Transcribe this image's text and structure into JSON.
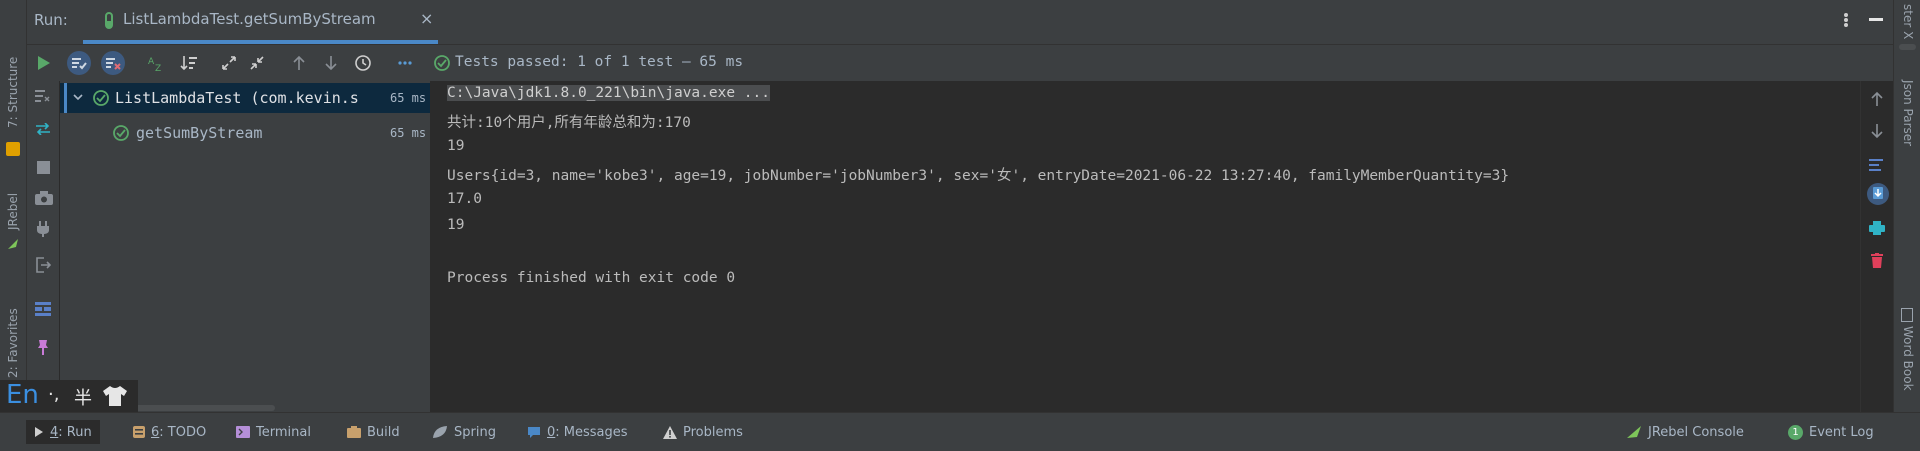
{
  "run_panel": {
    "label": "Run:",
    "tab_title": "ListLambdaTest.getSumByStream",
    "status": "Tests passed: 1 of 1 test – 65 ms"
  },
  "left_strip": {
    "structure_label": "7: Structure",
    "jrebel_label": "JRebel",
    "favorites_label": "2: Favorites"
  },
  "right_strip": {
    "top_label": "ster X",
    "json_label": "Json Parser",
    "word_label": "Word Book"
  },
  "tree": {
    "root": {
      "label": "ListLambdaTest (com.kevin.s",
      "time": "65 ms"
    },
    "child": {
      "label": "getSumByStream",
      "time": "65 ms"
    }
  },
  "console": {
    "lines": [
      "C:\\Java\\jdk1.8.0_221\\bin\\java.exe ...",
      "共计:10个用户,所有年龄总和为:170",
      "19",
      "Users{id=3, name='kobe3', age=19, jobNumber='jobNumber3', sex='女', entryDate=2021-06-22 13:27:40, familyMemberQuantity=3}",
      "17.0",
      "19",
      "",
      "Process finished with exit code 0"
    ]
  },
  "bottom_bar": {
    "run": {
      "num": "4",
      "label": ": Run"
    },
    "todo": {
      "num": "6",
      "label": ": TODO"
    },
    "terminal": "Terminal",
    "build": "Build",
    "spring": "Spring",
    "messages": {
      "num": "0",
      "label": ": Messages"
    },
    "problems": "Problems",
    "jrebel_console": "JRebel Console",
    "event_log": "Event Log",
    "event_count": "1"
  },
  "ime": {
    "lang": "En",
    "punct": "·,",
    "width": "半"
  },
  "colors": {
    "pass_green": "#59a869",
    "accent_blue": "#4a88c7",
    "delete_red": "#e0405b",
    "print_cyan": "#30b3c6"
  }
}
